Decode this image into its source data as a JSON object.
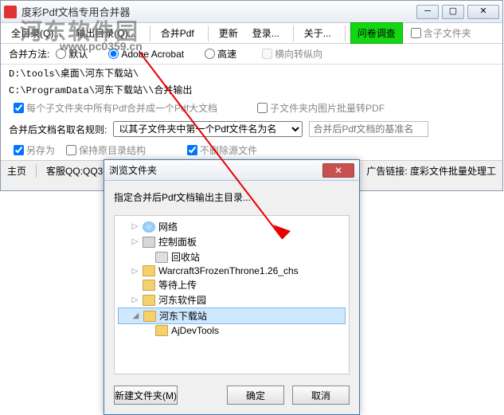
{
  "main": {
    "title": "度彩Pdf文档专用合并器",
    "toolbar": {
      "all_dir": "全目录(Q)...",
      "out_dir": "输出目录(Q)...",
      "merge": "合并Pdf",
      "update": "更新",
      "login": "登录...",
      "about": "关于...",
      "survey": "问卷调查",
      "include_sub": "含子文件夹"
    },
    "method_label": "合并方法:",
    "method_default": "默认",
    "method_acrobat": "Adobe Acrobat",
    "method_fast": "高速",
    "hv_convert": "横向转纵向",
    "path1": "D:\\tools\\桌面\\河东下载站\\",
    "path2": "C:\\ProgramData\\河东下载站\\\\合并输出",
    "merge_each": "每个子文件夹中所有Pdf合并成一个Pdf大文档",
    "sub_img_pdf": "子文件夹内图片批量转PDF",
    "name_rule_label": "合并后文档名取名规则:",
    "name_rule_value": "以其子文件夹中第一个Pdf文件名为名",
    "basename_ph": "合并后Pdf文档的基准名",
    "save_as": "另存为",
    "keep_struct": "保持原目录结构",
    "no_delete": "不删除源文件",
    "status_home": "主页",
    "status_qq": "客服QQ:QQ32",
    "status_ad": "广告链接: 度彩文件批量处理工"
  },
  "dialog": {
    "title": "浏览文件夹",
    "prompt": "指定合并后Pdf文档输出主目录...",
    "items": {
      "net": "网络",
      "cp": "控制面板",
      "bin": "回收站",
      "wc3": "Warcraft3FrozenThrone1.26_chs",
      "wait": "等待上传",
      "soft": "河东软件园",
      "dl": "河东下载站",
      "aj": "AjDevTools"
    },
    "new_folder": "新建文件夹(M)",
    "ok": "确定",
    "cancel": "取消"
  },
  "watermark": {
    "text1": "河东软件园",
    "text2": "www.pc0359.cn"
  }
}
